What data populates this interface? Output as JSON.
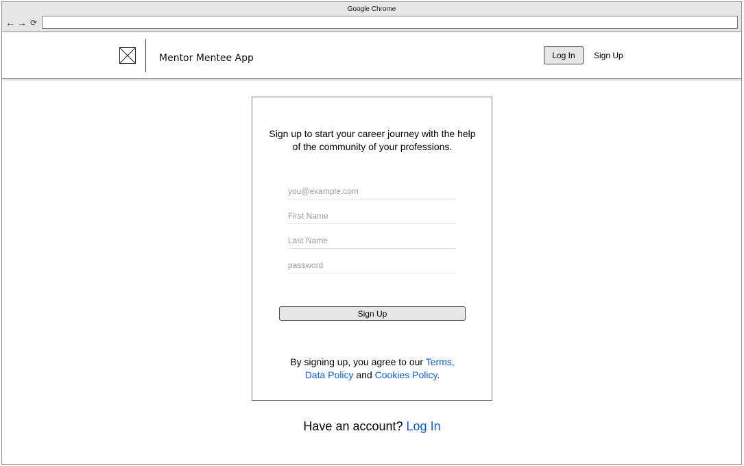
{
  "browser": {
    "window_title": "Google Chrome",
    "back_icon": "arrow-left-icon",
    "forward_icon": "arrow-right-icon",
    "reload_icon": "reload-icon",
    "address": ""
  },
  "header": {
    "logo_icon": "image-placeholder-icon",
    "app_title": "Mentor Mentee App",
    "login_label": "Log In",
    "signup_label": "Sign Up"
  },
  "signup_form": {
    "intro": "Sign up to start your career journey with the help of the community of your professions.",
    "fields": [
      {
        "placeholder": "you@example.com",
        "value": ""
      },
      {
        "placeholder": "First Name",
        "value": ""
      },
      {
        "placeholder": "Last Name",
        "value": ""
      },
      {
        "placeholder": "password",
        "value": ""
      }
    ],
    "submit_label": "Sign Up",
    "terms": {
      "prefix": "By signing up, you agree to our ",
      "terms_link": "Terms,",
      "data_policy_link": "Data Policy",
      "and_text": " and ",
      "cookies_link": "Cookies Policy",
      "suffix": "."
    }
  },
  "footer": {
    "question": "Have an account? ",
    "login_link": "Log In"
  },
  "colors": {
    "link": "#0b5dd6",
    "button_bg": "#e6e6e6",
    "chrome_bg": "#e6e6e6"
  }
}
